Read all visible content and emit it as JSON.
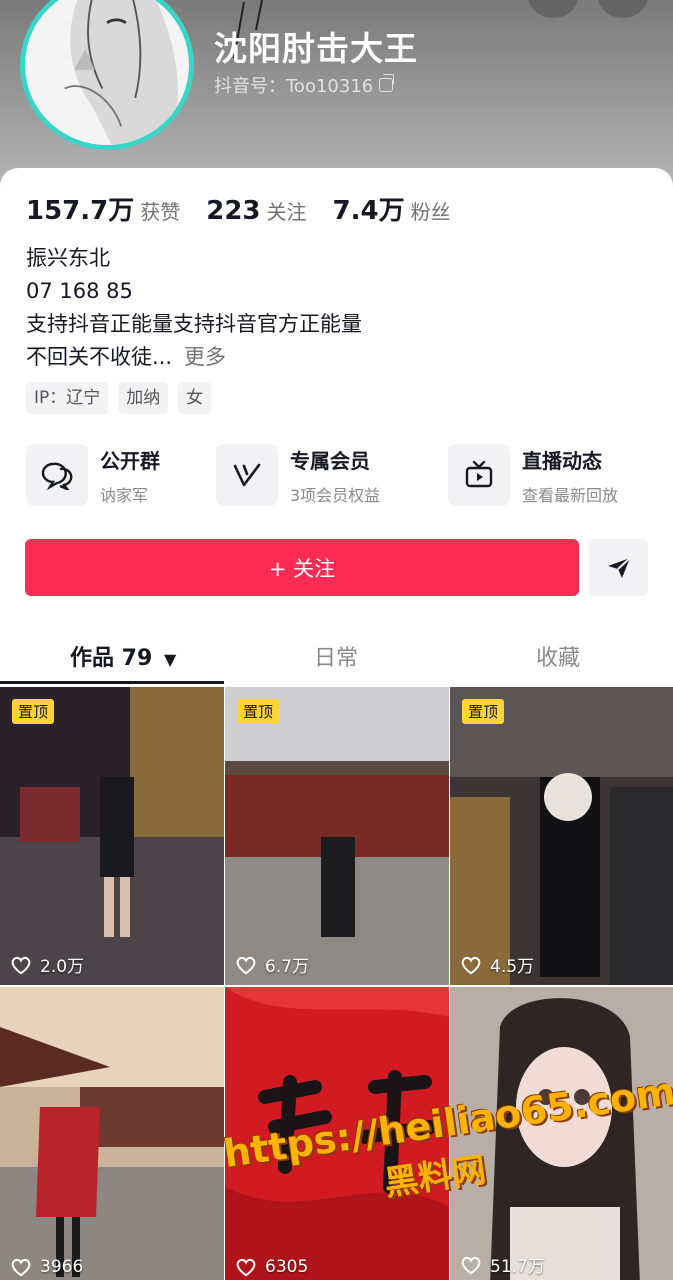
{
  "profile": {
    "nickname": "沈阳肘击大王",
    "account_label": "抖音号：Too10316"
  },
  "stats": [
    {
      "num": "157.7万",
      "label": "获赞"
    },
    {
      "num": "223",
      "label": "关注"
    },
    {
      "num": "7.4万",
      "label": "粉丝"
    }
  ],
  "bio": {
    "line1": "振兴东北",
    "line2": "07 168 85",
    "line3": "支持抖音正能量支持抖音官方正能量",
    "line4": "不回关不收徒...",
    "more": "更多"
  },
  "tags": [
    "IP：辽宁",
    "加纳",
    "女"
  ],
  "features": [
    {
      "title": "公开群",
      "sub": "讷家军",
      "icon": "chat-bubbles-icon"
    },
    {
      "title": "专属会员",
      "sub": "3项会员权益",
      "icon": "v-badge-icon"
    },
    {
      "title": "直播动态",
      "sub": "查看最新回放",
      "icon": "tv-icon"
    }
  ],
  "actions": {
    "follow": "+ 关注",
    "send_icon": "send-icon"
  },
  "tabs": {
    "works": "作品 79",
    "daily": "日常",
    "favorites": "收藏"
  },
  "videos": [
    {
      "pinned": "置顶",
      "likes": "2.0万"
    },
    {
      "pinned": "置顶",
      "likes": "6.7万"
    },
    {
      "pinned": "置顶",
      "likes": "4.5万"
    },
    {
      "pinned": "",
      "likes": "3966"
    },
    {
      "pinned": "",
      "likes": "6305"
    },
    {
      "pinned": "",
      "likes": "51.7万"
    }
  ],
  "watermark": {
    "url": "https://heiliao65.com",
    "name": "黑料网"
  },
  "colors": {
    "follow": "#fe2c55",
    "avatar_ring": "#38d6c8",
    "pin_badge": "#ffd33a"
  }
}
